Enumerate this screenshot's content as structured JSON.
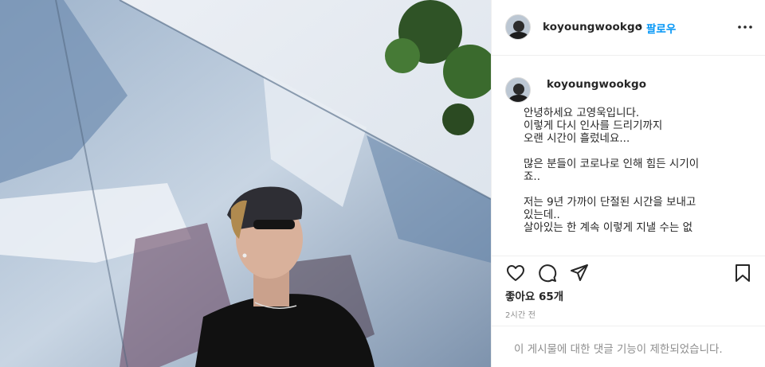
{
  "post": {
    "username": "koyoungwookgo",
    "dot": "•",
    "follow_label": "팔로우",
    "caption_username": "koyoungwookgo",
    "caption_text": "안녕하세요 고영욱입니다.\n이렇게 다시 인사를 드리기까지\n오랜 시간이 흘렀네요...\n\n많은 분들이 코로나로 인해 힘든 시기이\n죠..\n\n저는 9년 가까이 단절된 시간을 보내고\n있는데..\n살아있는 한 계속 이렇게 지낼 수는 없",
    "likes": "좋아요 65개",
    "time": "2시간 전",
    "comments_disabled": "이 게시물에 대한 댓글 기능이 제한되었습니다."
  },
  "icons": {
    "more": "more-horizontal-icon",
    "like": "heart-icon",
    "comment": "comment-icon",
    "share": "share-icon",
    "save": "bookmark-icon"
  },
  "colors": {
    "follow": "#0095f6",
    "text": "#262626",
    "muted": "#8e8e8e",
    "border": "#efefef"
  }
}
